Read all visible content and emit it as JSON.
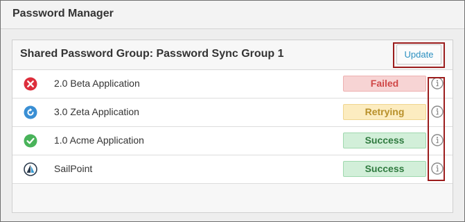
{
  "app": {
    "title": "Password Manager"
  },
  "group": {
    "title": "Shared Password Group: Password Sync Group 1"
  },
  "toolbar": {
    "update_label": "Update",
    "update_color": "#2a8fc0"
  },
  "rows": [
    {
      "label": "2.0 Beta Application",
      "status": "Failed",
      "icon": "error-x-icon",
      "badge_bg": "#f7d4d4",
      "badge_border": "#eeb0b0",
      "badge_text": "#d04848"
    },
    {
      "label": "3.0 Zeta Application",
      "status": "Retrying",
      "icon": "retry-icon",
      "badge_bg": "#fcecc0",
      "badge_border": "#f0d58e",
      "badge_text": "#b8902a"
    },
    {
      "label": "1.0 Acme Application",
      "status": "Success",
      "icon": "checkmark-icon",
      "badge_bg": "#d2efd9",
      "badge_border": "#9fd8ae",
      "badge_text": "#2f7a3f"
    },
    {
      "label": "SailPoint",
      "status": "Success",
      "icon": "sailpoint-logo-icon",
      "badge_bg": "#d2efd9",
      "badge_border": "#9fd8ae",
      "badge_text": "#2f7a3f"
    }
  ],
  "colors": {
    "highlight_outline": "#9b1c1c"
  }
}
